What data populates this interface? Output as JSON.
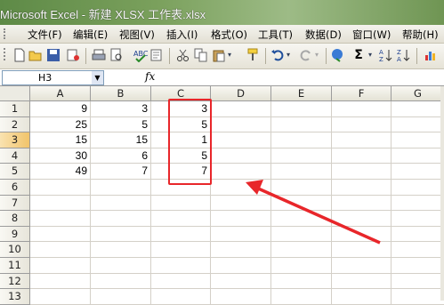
{
  "window": {
    "title": "Microsoft Excel - 新建 XLSX 工作表.xlsx"
  },
  "menu": [
    {
      "label": "文件(F)"
    },
    {
      "label": "编辑(E)"
    },
    {
      "label": "视图(V)"
    },
    {
      "label": "插入(I)"
    },
    {
      "label": "格式(O)"
    },
    {
      "label": "工具(T)"
    },
    {
      "label": "数据(D)"
    },
    {
      "label": "窗口(W)"
    },
    {
      "label": "帮助(H)"
    }
  ],
  "toolbar_icons": [
    "new-icon",
    "open-icon",
    "save-icon",
    "permission-icon",
    "print-icon",
    "print-preview-icon",
    "spelling-icon",
    "cut-icon",
    "copy-icon",
    "paste-icon",
    "format-painter-icon",
    "undo-icon",
    "redo-icon",
    "hyperlink-icon",
    "autosum-icon",
    "sort-ascending-icon",
    "sort-descending-icon",
    "chart-wizard-icon"
  ],
  "formula_bar": {
    "name_box": "H3",
    "fx": "fx"
  },
  "columns": [
    "A",
    "B",
    "C",
    "D",
    "E",
    "F",
    "G"
  ],
  "rows": [
    "1",
    "2",
    "3",
    "4",
    "5",
    "6",
    "7",
    "8",
    "9",
    "10",
    "11",
    "12",
    "13"
  ],
  "cells": {
    "A": [
      "9",
      "25",
      "15",
      "30",
      "49"
    ],
    "B": [
      "3",
      "5",
      "15",
      "6",
      "7"
    ],
    "C": [
      "3",
      "5",
      "1",
      "5",
      "7"
    ]
  },
  "selected_cell": "H3",
  "annotation": {
    "color": "#e8262a"
  }
}
